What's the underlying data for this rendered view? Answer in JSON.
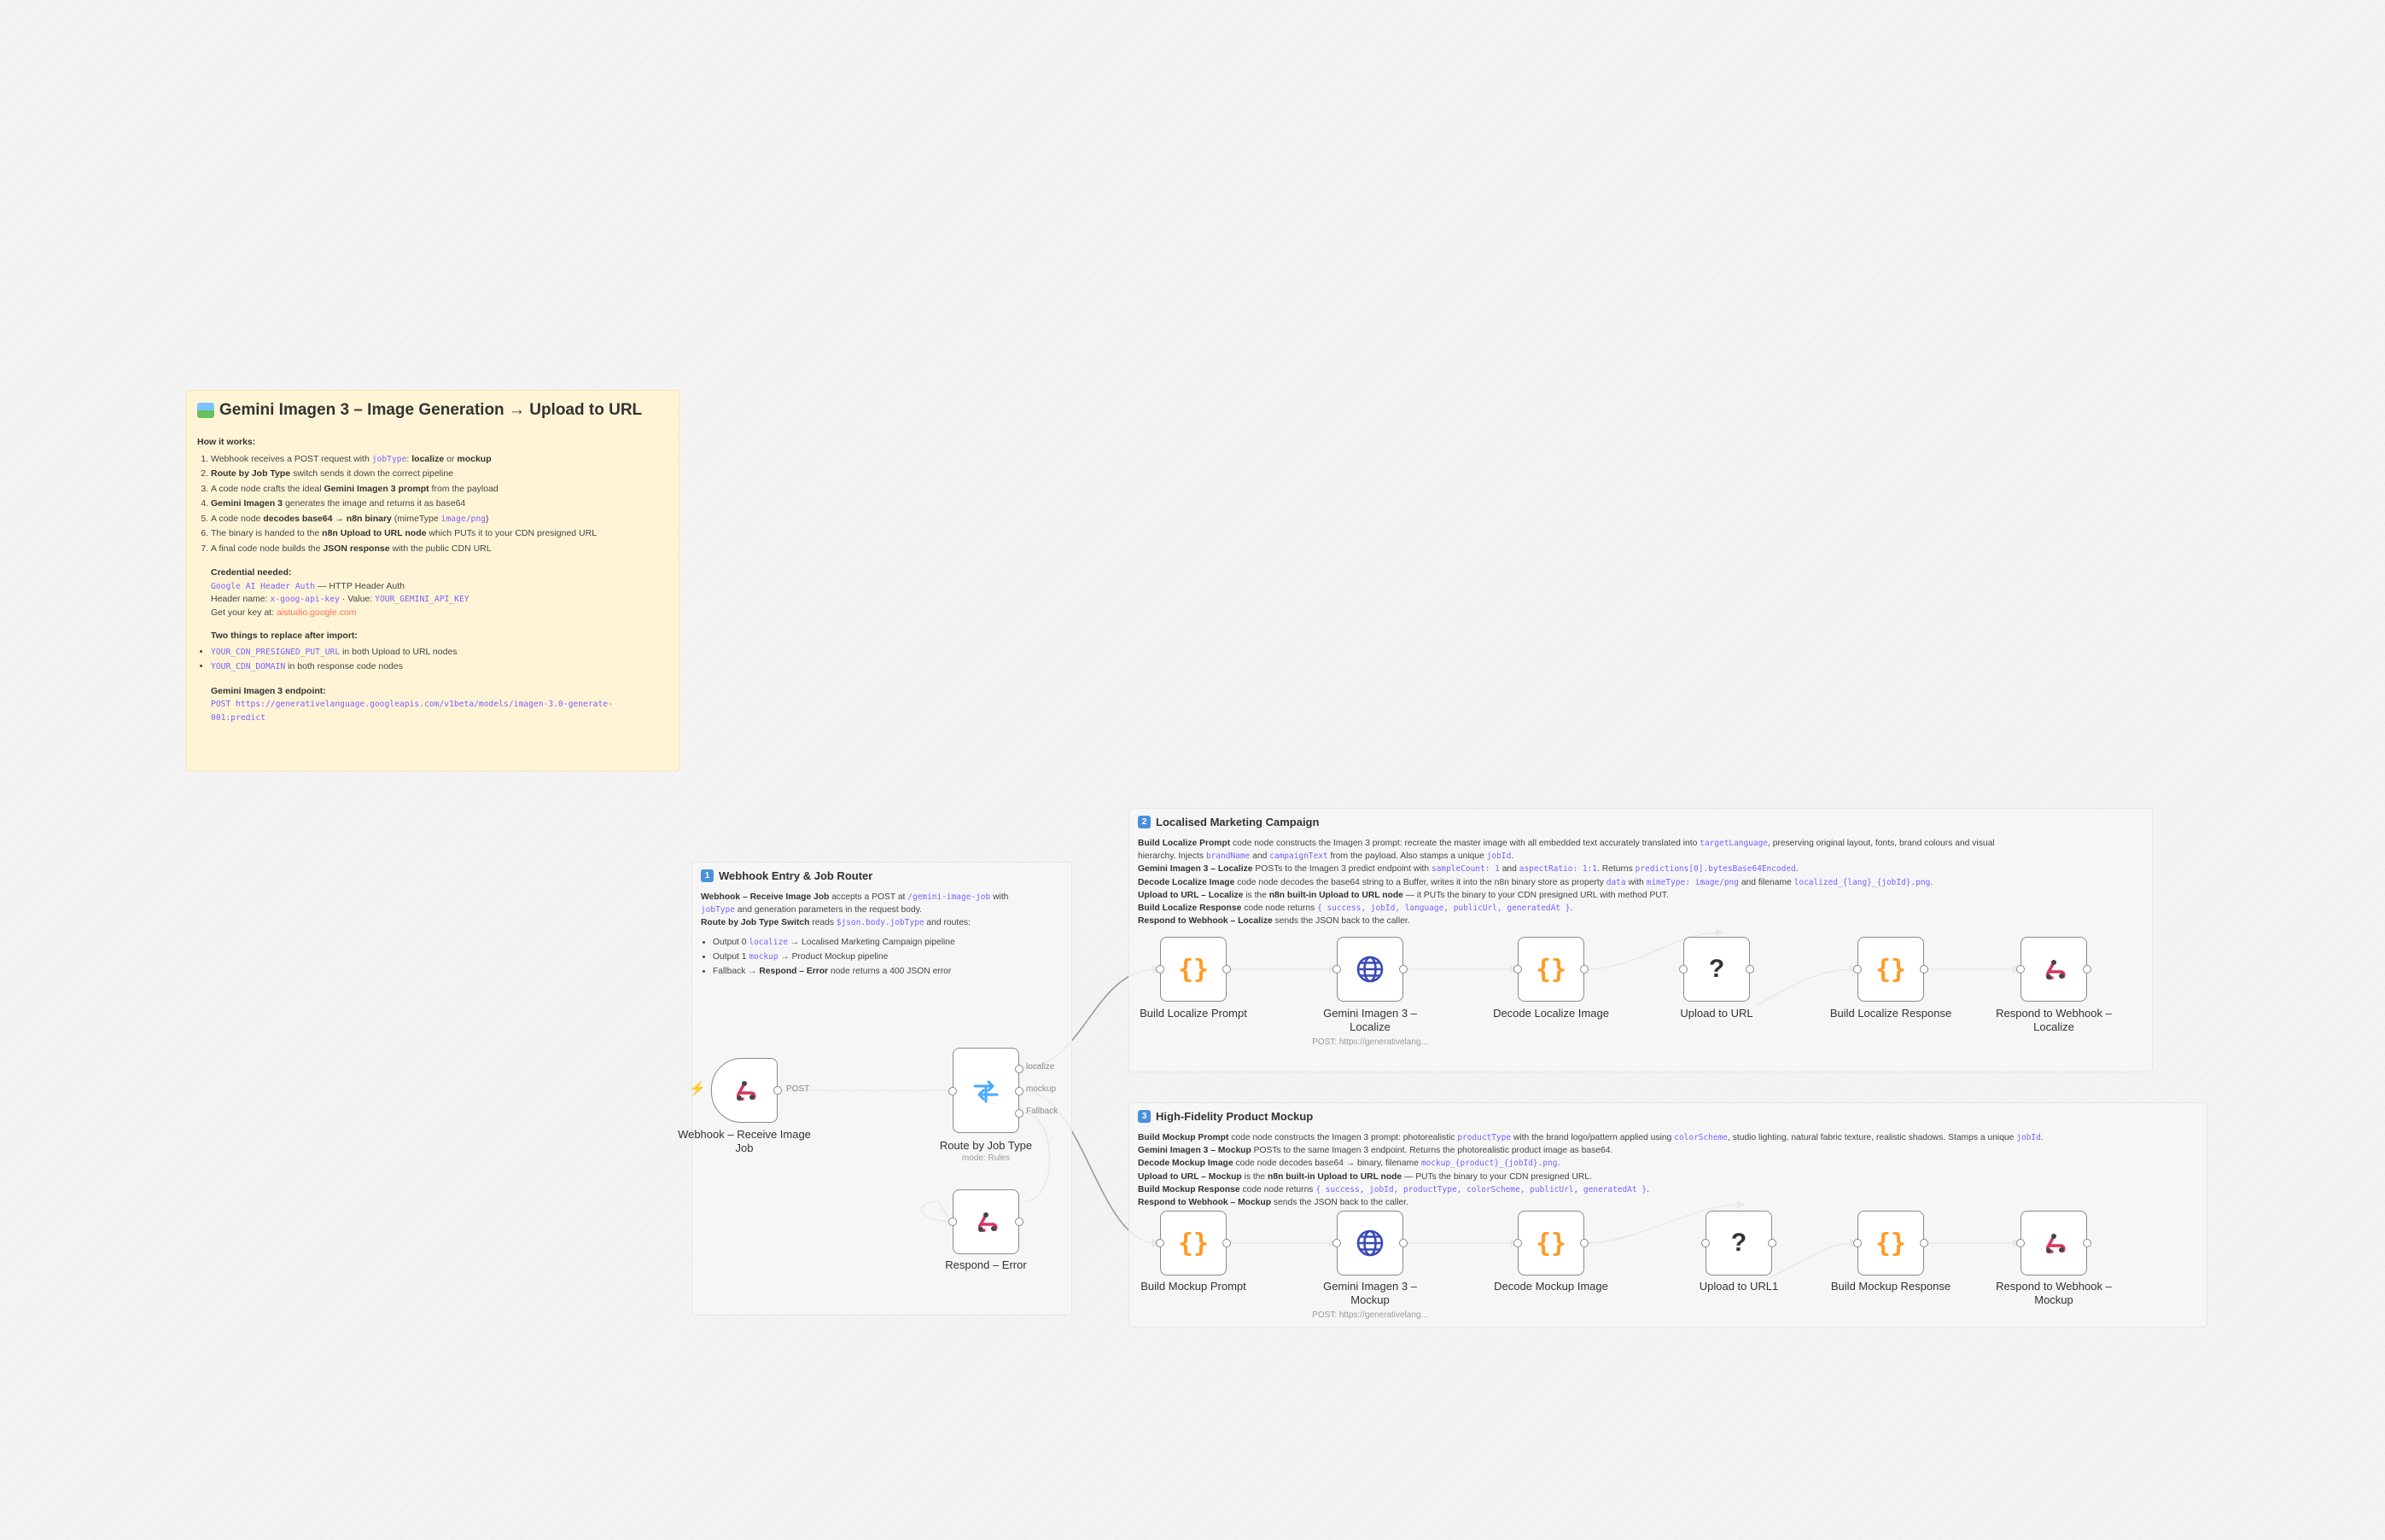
{
  "main_note": {
    "title": "Gemini Imagen 3 – Image Generation → Upload to URL",
    "how_heading": "How it works:",
    "steps": [
      "Webhook receives a POST request with jobType: localize or mockup",
      "Route by Job Type switch sends it down the correct pipeline",
      "A code node crafts the ideal Gemini Imagen 3 prompt from the payload",
      "Gemini Imagen 3 generates the image and returns it as base64",
      "A code node decodes base64 → n8n binary (mimeType image/png)",
      "The binary is handed to the n8n Upload to URL node which PUTs it to your CDN presigned URL",
      "A final code node builds the JSON response with the public CDN URL"
    ],
    "credential_heading": "Credential needed:",
    "credential_name": "Google AI Header Auth",
    "credential_type": "— HTTP Header Auth",
    "header_name_label": "Header name:",
    "header_name": "x-goog-api-key",
    "value_label": "· Value:",
    "value": "YOUR_GEMINI_API_KEY",
    "get_key_label": "Get your key at:",
    "get_key_link": "aistudio.google.com",
    "replace_heading": "Two things to replace after import:",
    "replace_1_code": "YOUR_CDN_PRESIGNED_PUT_URL",
    "replace_1_text": "in both Upload to URL nodes",
    "replace_2_code": "YOUR_CDN_DOMAIN",
    "replace_2_text": "in both response code nodes",
    "endpoint_heading": "Gemini Imagen 3 endpoint:",
    "endpoint": "POST https://generativelanguage.googleapis.com/v1beta/models/imagen-3.0-generate-001:predict"
  },
  "router_note": {
    "badge": "1",
    "title": "Webhook Entry & Job Router",
    "line1_a": "Webhook – Receive Image Job",
    "line1_b": "accepts a POST at",
    "line1_code": "/gemini-image-job",
    "line1_c": "with",
    "line2_code": "jobType",
    "line2_b": "and generation parameters in the request body.",
    "line3_a": "Route by Job Type Switch",
    "line3_b": "reads",
    "line3_code": "$json.body.jobType",
    "line3_c": "and routes:",
    "bullet1_a": "Output 0",
    "bullet1_code": "localize",
    "bullet1_b": "→ Localised Marketing Campaign pipeline",
    "bullet2_a": "Output 1",
    "bullet2_code": "mockup",
    "bullet2_b": "→ Product Mockup pipeline",
    "bullet3_a": "Fallback →",
    "bullet3_bold": "Respond – Error",
    "bullet3_b": "node returns a 400 JSON error"
  },
  "localize_note": {
    "badge": "2",
    "title": "Localised Marketing Campaign",
    "l1_bold": "Build Localize Prompt",
    "l1_a": "code node constructs the Imagen 3 prompt: recreate the master image with all embedded text accurately translated into",
    "l1_code": "targetLanguage",
    "l1_b": ", preserving original layout, fonts, brand colours and visual",
    "l2_a": "hierarchy. Injects",
    "l2_code1": "brandName",
    "l2_b": "and",
    "l2_code2": "campaignText",
    "l2_c": "from the payload. Also stamps a unique",
    "l2_code3": "jobId",
    "l3_bold": "Gemini Imagen 3 – Localize",
    "l3_a": "POSTs to the Imagen 3 predict endpoint with",
    "l3_code1": "sampleCount: 1",
    "l3_b": "and",
    "l3_code2": "aspectRatio: 1:1",
    "l3_c": ". Returns",
    "l3_code3": "predictions[0].bytesBase64Encoded",
    "l4_bold": "Decode Localize Image",
    "l4_a": "code node decodes the base64 string to a Buffer, writes it into the n8n binary store as property",
    "l4_code1": "data",
    "l4_b": "with",
    "l4_code2": "mimeType: image/png",
    "l4_c": "and filename",
    "l4_code3": "localized_{lang}_{jobId}.png",
    "l5_bold": "Upload to URL – Localize",
    "l5_a": "is the",
    "l5_bold2": "n8n built-in Upload to URL node",
    "l5_b": "— it PUTs the binary to your CDN presigned URL with method PUT.",
    "l6_bold": "Build Localize Response",
    "l6_a": "code node returns",
    "l6_code": "{ success, jobId, language, publicUrl, generatedAt }",
    "l7_bold": "Respond to Webhook – Localize",
    "l7_a": "sends the JSON back to the caller."
  },
  "mockup_note": {
    "badge": "3",
    "title": "High-Fidelity Product Mockup",
    "l1_bold": "Build Mockup Prompt",
    "l1_a": "code node constructs the Imagen 3 prompt: photorealistic",
    "l1_code1": "productType",
    "l1_b": "with the brand logo/pattern applied using",
    "l1_code2": "colorScheme",
    "l1_c": ", studio lighting, natural fabric texture, realistic shadows. Stamps a unique",
    "l1_code3": "jobId",
    "l2_bold": "Gemini Imagen 3 – Mockup",
    "l2_a": "POSTs to the same Imagen 3 endpoint. Returns the photorealistic product image as base64.",
    "l3_bold": "Decode Mockup Image",
    "l3_a": "code node decodes base64 → binary, filename",
    "l3_code": "mockup_{product}_{jobId}.png",
    "l4_bold": "Upload to URL – Mockup",
    "l4_a": "is the",
    "l4_bold2": "n8n built-in Upload to URL node",
    "l4_b": "— PUTs the binary to your CDN presigned URL.",
    "l5_bold": "Build Mockup Response",
    "l5_a": "code node returns",
    "l5_code": "{ success, jobId, productType, colorScheme, publicUrl, generatedAt }",
    "l6_bold": "Respond to Webhook – Mockup",
    "l6_a": "sends the JSON back to the caller."
  },
  "nodes": {
    "webhook": {
      "label": "Webhook – Receive Image Job",
      "port": "POST",
      "icon": "webhook-icon"
    },
    "router": {
      "label": "Route by Job Type",
      "sub": "mode: Rules",
      "out0": "localize",
      "out1": "mockup",
      "out2": "Fallback",
      "icon": "switch-icon"
    },
    "respond_error": {
      "label": "Respond – Error",
      "icon": "webhook-icon"
    },
    "build_localize": {
      "label": "Build Localize Prompt",
      "glyph": "{}"
    },
    "gemini_localize": {
      "label": "Gemini Imagen 3 – Localize",
      "sub": "POST: https://generativelang...",
      "icon": "globe-icon"
    },
    "decode_localize": {
      "label": "Decode Localize Image",
      "glyph": "{}"
    },
    "upload_url": {
      "label": "Upload to URL",
      "glyph": "?"
    },
    "build_localize_resp": {
      "label": "Build Localize Response",
      "glyph": "{}"
    },
    "respond_localize": {
      "label": "Respond to Webhook – Localize",
      "icon": "webhook-icon"
    },
    "build_mockup": {
      "label": "Build Mockup Prompt",
      "glyph": "{}"
    },
    "gemini_mockup": {
      "label": "Gemini Imagen 3 – Mockup",
      "sub": "POST: https://generativelang...",
      "icon": "globe-icon"
    },
    "decode_mockup": {
      "label": "Decode Mockup Image",
      "glyph": "{}"
    },
    "upload_url1": {
      "label": "Upload to URL1",
      "glyph": "?"
    },
    "build_mockup_resp": {
      "label": "Build Mockup Response",
      "glyph": "{}"
    },
    "respond_mockup": {
      "label": "Respond to Webhook – Mockup",
      "icon": "webhook-icon"
    }
  },
  "colors": {
    "code_glyph": "#ff9b26",
    "http_icon": "#3a4ab8",
    "webhook_icon": "#d6365e",
    "inline_code": "#7b61ff",
    "link": "#ff6d5a",
    "note_yellow": "#fff5d6"
  }
}
